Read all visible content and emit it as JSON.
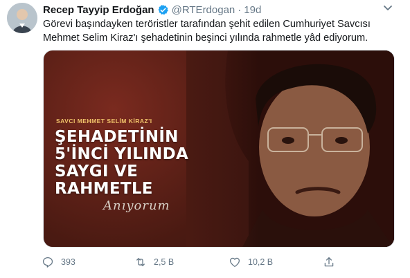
{
  "tweet": {
    "author_name": "Recep Tayyip Erdoğan",
    "handle": "@RTErdogan",
    "separator": "·",
    "time": "19d",
    "text_lines": [
      "Görevi başındayken teröristler tarafından şehit edilen Cumhuriyet Savcısı",
      "Mehmet Selim Kiraz'ı şehadetinin beşinci yılında rahmetle yâd ediyorum."
    ]
  },
  "media": {
    "subtitle": "SAVCI MEHMET SELİM KİRAZ'I",
    "headline_lines": [
      "ŞEHADETİNİN",
      "5'İNCİ YILINDA",
      "SAYGI VE",
      "RAHMETLE"
    ],
    "signature": "Anıyorum"
  },
  "actions": {
    "reply_count": "393",
    "retweet_count": "2,5 B",
    "like_count": "10,2 B"
  },
  "icons": {
    "verified": "verified-badge-icon",
    "caret": "chevron-down-icon",
    "reply": "reply-icon",
    "retweet": "retweet-icon",
    "like": "heart-icon",
    "share": "share-icon"
  },
  "colors": {
    "verified_blue": "#1da1f2",
    "secondary_text": "#657786",
    "poster_red": "#5a1d14",
    "poster_gold": "#f0c36a"
  }
}
